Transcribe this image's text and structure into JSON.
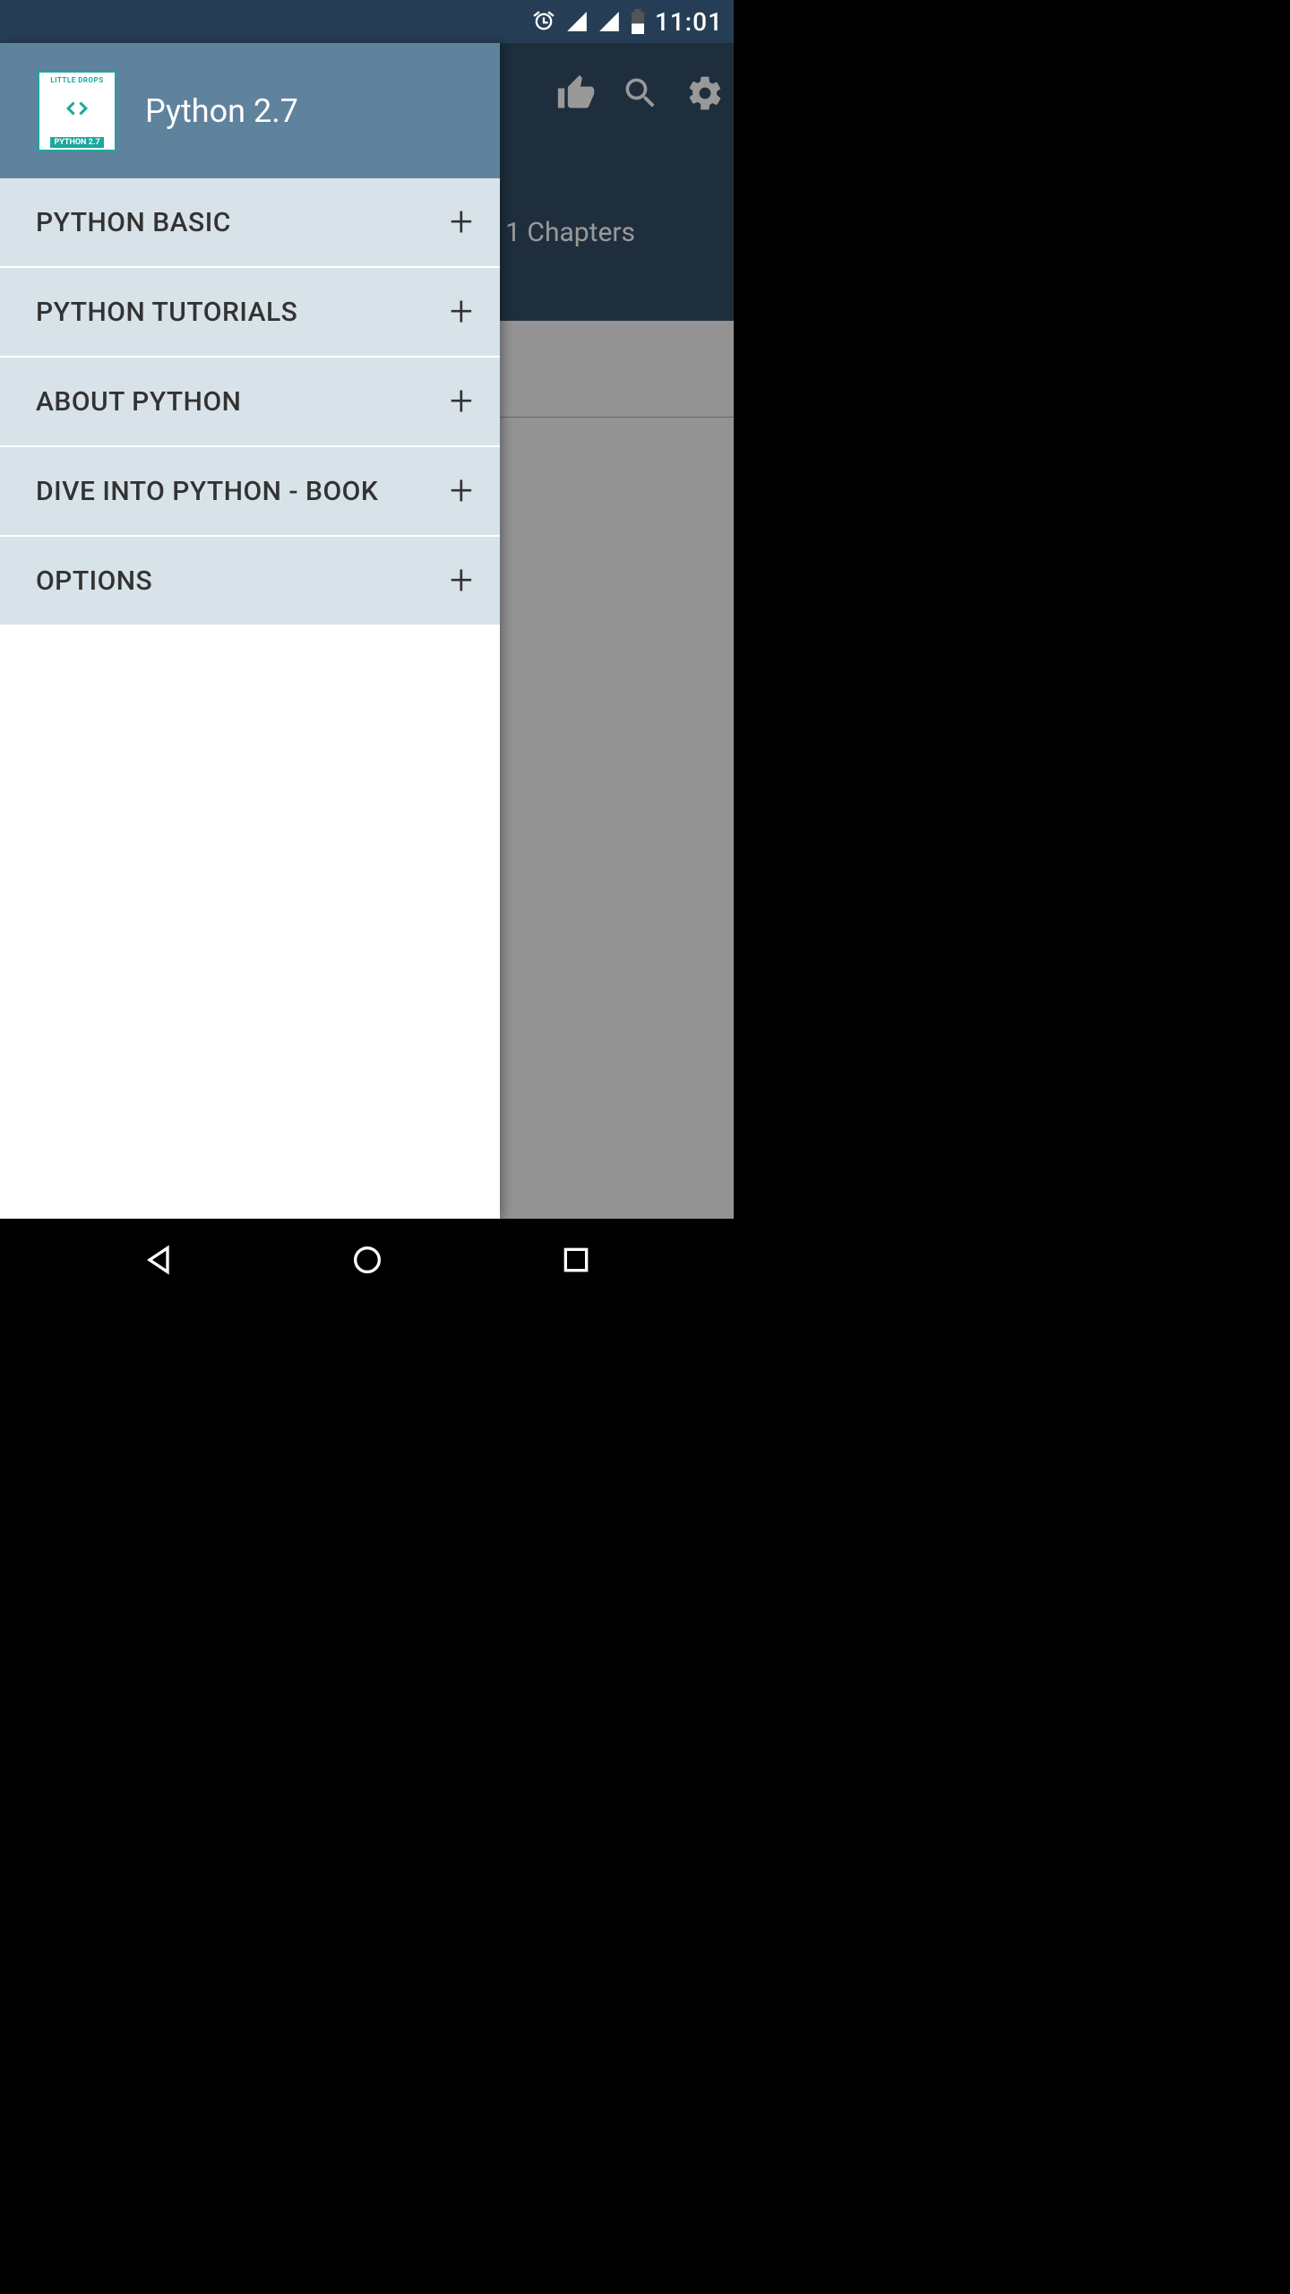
{
  "status": {
    "time": "11:01"
  },
  "drawer": {
    "title": "Python 2.7",
    "logo_top": "LITTLE DROPS",
    "logo_bottom": "PYTHON 2.7",
    "items": [
      {
        "label": "PYTHON BASIC"
      },
      {
        "label": "PYTHON TUTORIALS"
      },
      {
        "label": "ABOUT PYTHON"
      },
      {
        "label": "DIVE INTO PYTHON - BOOK"
      },
      {
        "label": "OPTIONS"
      }
    ]
  },
  "background": {
    "chapters_text": "1 Chapters"
  }
}
